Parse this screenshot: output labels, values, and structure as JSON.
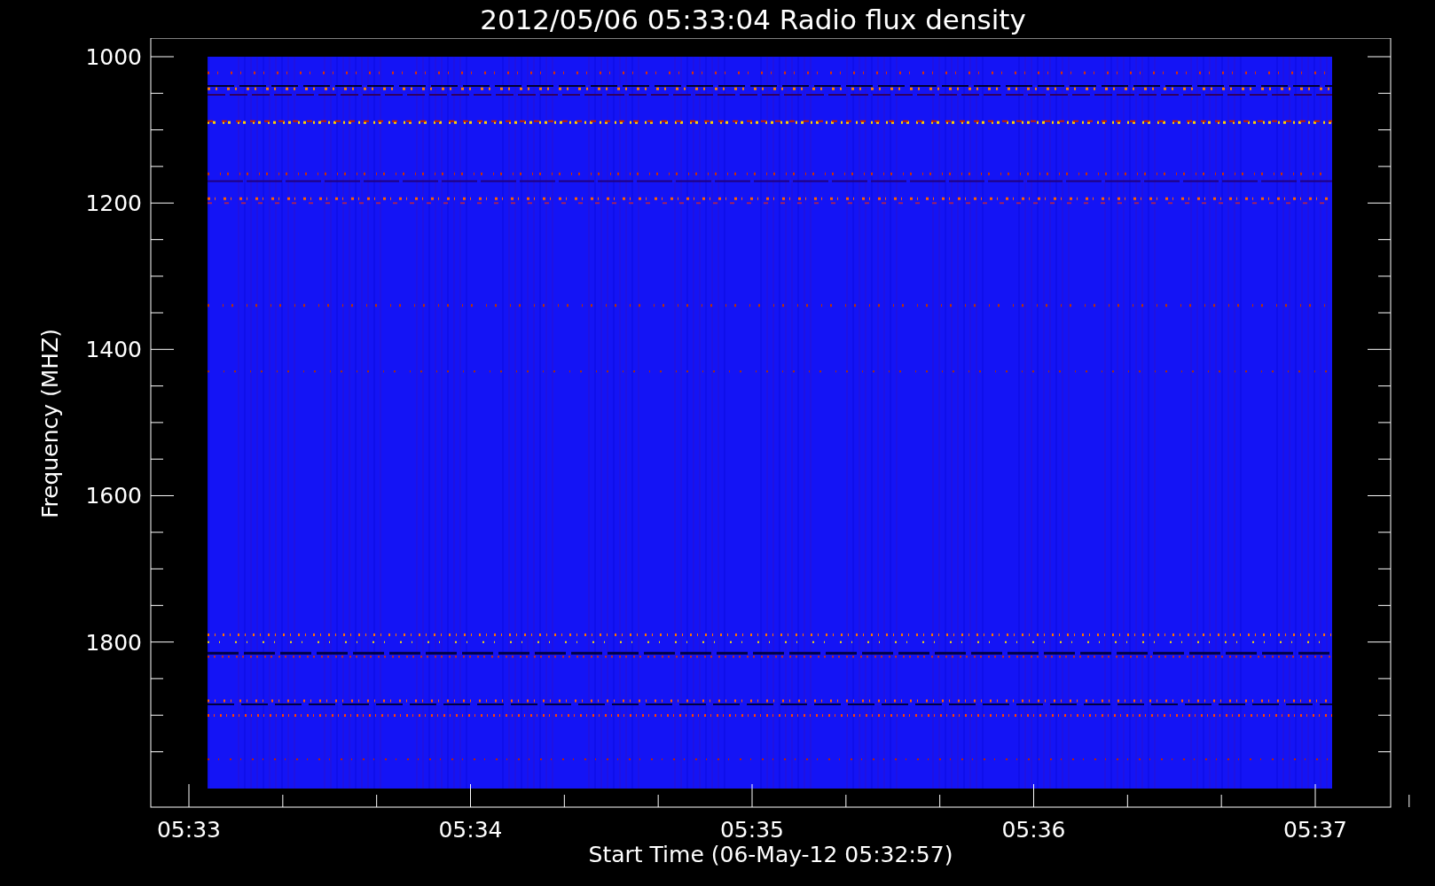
{
  "title": "2012/05/06 05:33:04 Radio flux density",
  "y_axis": {
    "label": "Frequency (MHZ)",
    "ticks": [
      "1000",
      "1200",
      "1400",
      "1600",
      "1800"
    ]
  },
  "x_axis": {
    "label": "Start Time (06-May-12 05:32:57)",
    "ticks": [
      "05:33",
      "05:34",
      "05:35",
      "05:36",
      "05:37"
    ]
  }
}
